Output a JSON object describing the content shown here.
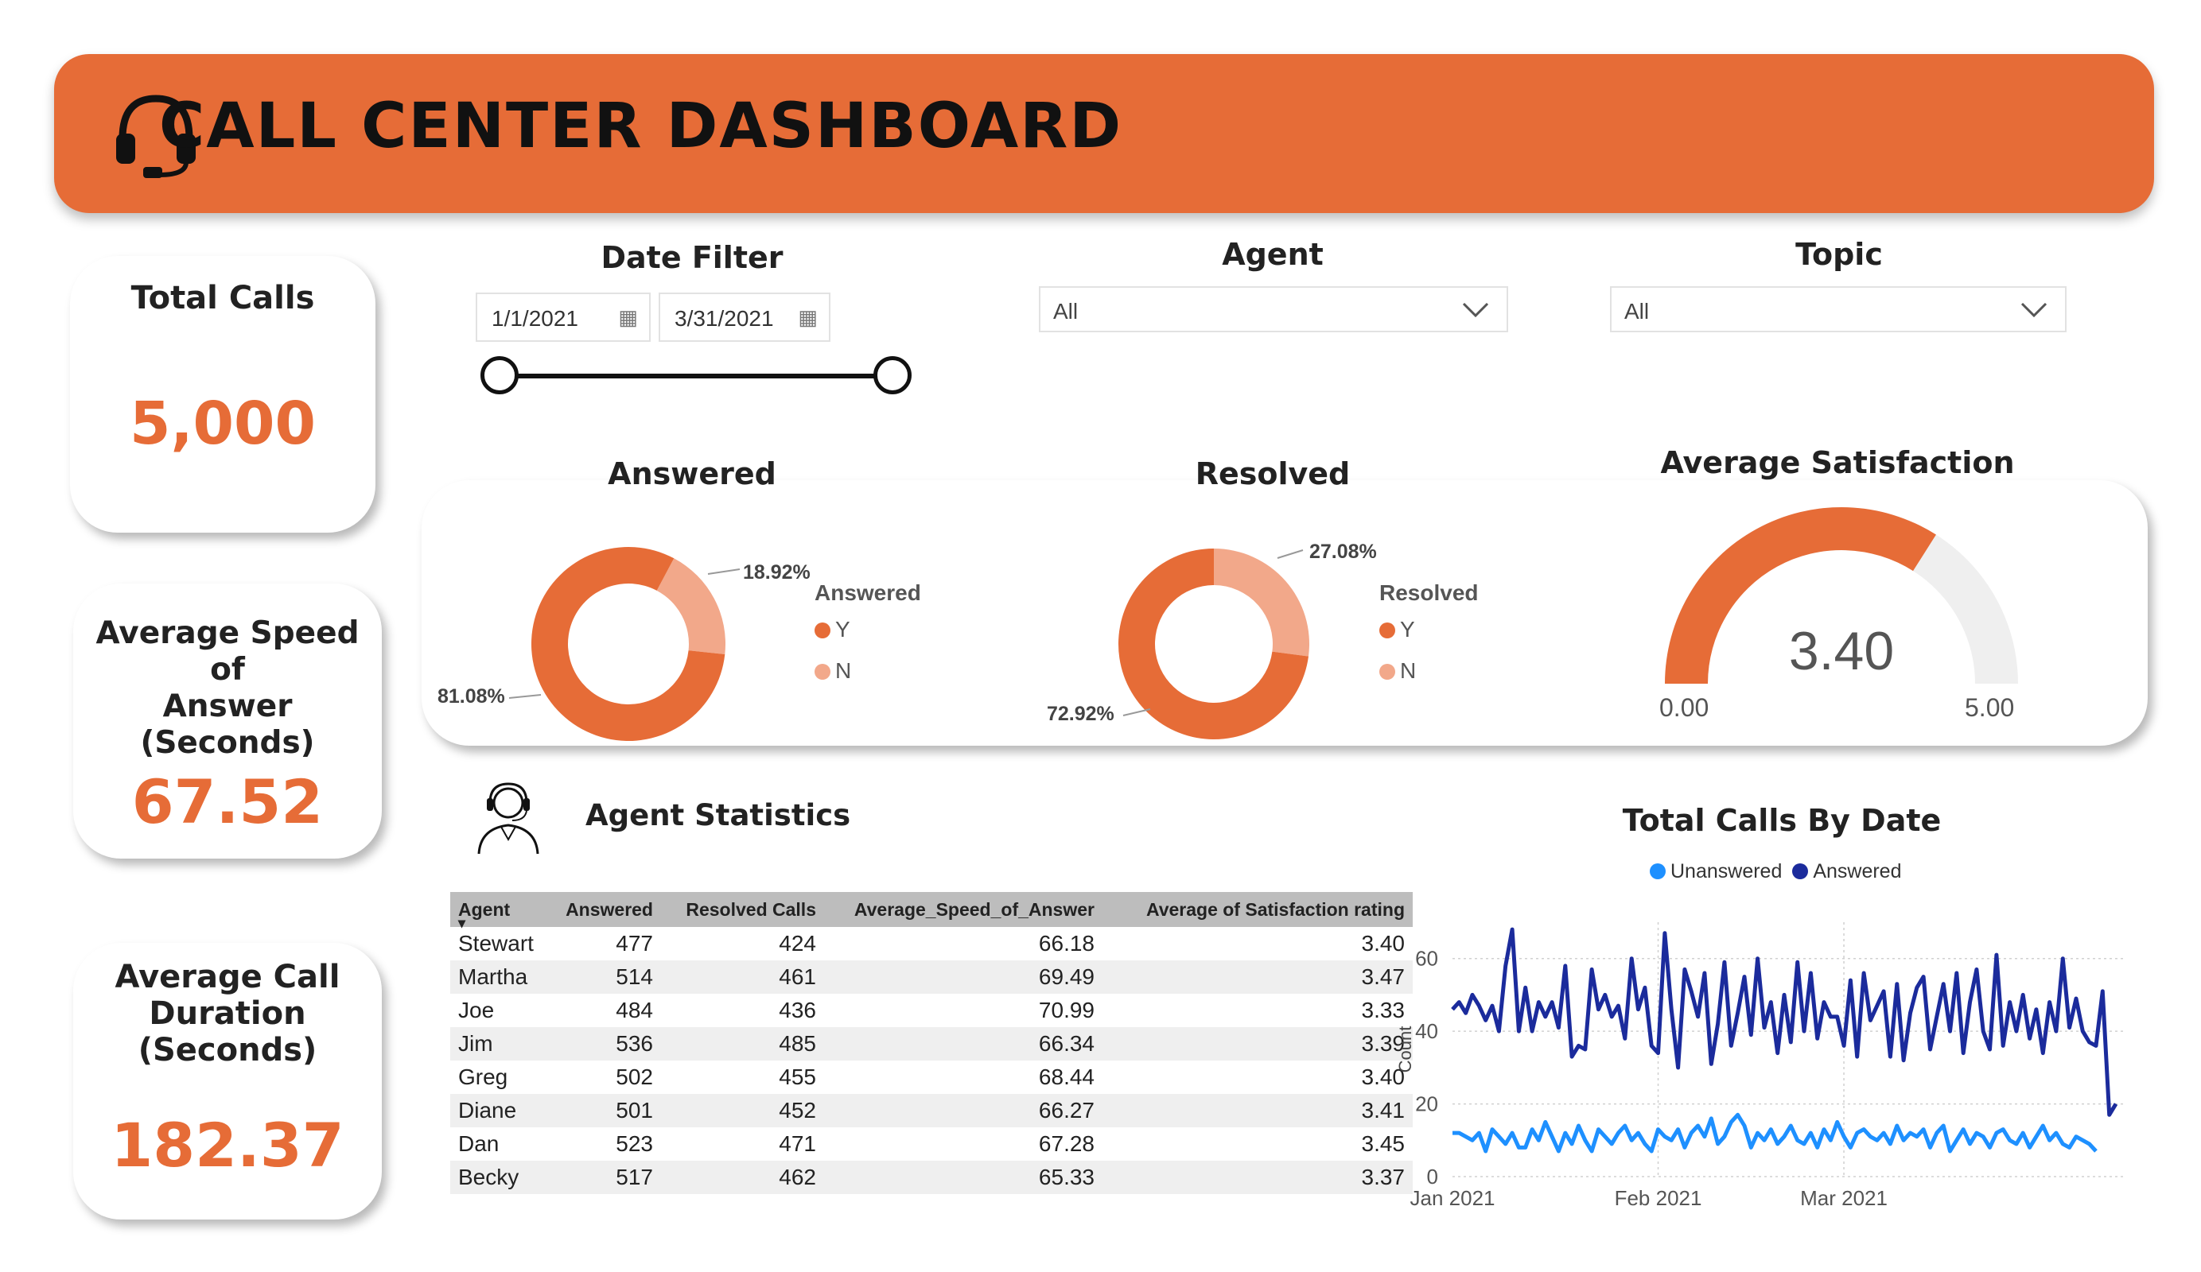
{
  "header": {
    "title": "CALL CENTER DASHBOARD",
    "icon": "headset-icon"
  },
  "kpis": {
    "total_calls": {
      "label": "Total Calls",
      "value": "5,000"
    },
    "avg_speed": {
      "label_lines": [
        "Average Speed of",
        "Answer",
        "(Seconds)"
      ],
      "value": "67.52"
    },
    "avg_duration": {
      "label_lines": [
        "Average Call",
        "Duration",
        "(Seconds)"
      ],
      "value": "182.37"
    }
  },
  "filters": {
    "date": {
      "title": "Date Filter",
      "start": "1/1/2021",
      "end": "3/31/2021"
    },
    "agent": {
      "title": "Agent",
      "value": "All"
    },
    "topic": {
      "title": "Topic",
      "value": "All"
    }
  },
  "answered": {
    "title": "Answered",
    "legend_title": "Answered",
    "legend": [
      "Y",
      "N"
    ],
    "labels": {
      "y": "81.08%",
      "n": "18.92%"
    }
  },
  "resolved": {
    "title": "Resolved",
    "legend_title": "Resolved",
    "legend": [
      "Y",
      "N"
    ],
    "labels": {
      "y": "72.92%",
      "n": "27.08%"
    }
  },
  "satisfaction": {
    "title": "Average Satisfaction",
    "value": "3.40",
    "min": "0.00",
    "max": "5.00"
  },
  "agent_stats": {
    "title": "Agent Statistics",
    "columns": [
      "Agent",
      "Answered",
      "Resolved Calls",
      "Average_Speed_of_Answer",
      "Average of Satisfaction rating"
    ],
    "rows": [
      [
        "Stewart",
        "477",
        "424",
        "66.18",
        "3.40"
      ],
      [
        "Martha",
        "514",
        "461",
        "69.49",
        "3.47"
      ],
      [
        "Joe",
        "484",
        "436",
        "70.99",
        "3.33"
      ],
      [
        "Jim",
        "536",
        "485",
        "66.34",
        "3.39"
      ],
      [
        "Greg",
        "502",
        "455",
        "68.44",
        "3.40"
      ],
      [
        "Diane",
        "501",
        "452",
        "66.27",
        "3.41"
      ],
      [
        "Dan",
        "523",
        "471",
        "67.28",
        "3.45"
      ],
      [
        "Becky",
        "517",
        "462",
        "65.33",
        "3.37"
      ]
    ]
  },
  "colors": {
    "accent": "#E66C37",
    "accent_light": "#F2A88A",
    "answered_line": "#1B2B9C",
    "unanswered_line": "#1E90FF"
  },
  "chart_data": [
    {
      "type": "pie",
      "title": "Answered",
      "categories": [
        "Y",
        "N"
      ],
      "values": [
        81.08,
        18.92
      ]
    },
    {
      "type": "pie",
      "title": "Resolved",
      "categories": [
        "Y",
        "N"
      ],
      "values": [
        72.92,
        27.08
      ]
    },
    {
      "type": "gauge",
      "title": "Average Satisfaction",
      "value": 3.4,
      "min": 0,
      "max": 5
    },
    {
      "type": "line",
      "title": "Total Calls By Date",
      "ylabel": "Count",
      "yticks": [
        "0",
        "20",
        "40",
        "60"
      ],
      "xticks": [
        "Jan 2021",
        "Feb 2021",
        "Mar 2021"
      ],
      "ylim": [
        0,
        70
      ],
      "x_start": "2021-01-01",
      "series": [
        {
          "name": "Unanswered",
          "color": "#1E90FF",
          "values": [
            12,
            12,
            11,
            10,
            12,
            7,
            13,
            11,
            9,
            12,
            8,
            8,
            13,
            10,
            15,
            11,
            7,
            12,
            9,
            14,
            10,
            7,
            13,
            11,
            9,
            12,
            14,
            10,
            12,
            9,
            7,
            13,
            11,
            10,
            13,
            8,
            12,
            14,
            11,
            16,
            9,
            11,
            15,
            17,
            14,
            8,
            12,
            10,
            13,
            9,
            11,
            14,
            10,
            9,
            12,
            8,
            13,
            10,
            15,
            11,
            8,
            12,
            13,
            11,
            10,
            12,
            9,
            14,
            10,
            12,
            11,
            13,
            8,
            12,
            14,
            7,
            10,
            13,
            9,
            12,
            11,
            8,
            12,
            13,
            10,
            9,
            12,
            8,
            11,
            14,
            10,
            12,
            9,
            8,
            11,
            10,
            9,
            7
          ]
        },
        {
          "name": "Answered",
          "color": "#1B2B9C",
          "values": [
            46,
            48,
            45,
            50,
            47,
            43,
            47,
            40,
            58,
            68,
            40,
            52,
            40,
            48,
            44,
            48,
            41,
            58,
            33,
            36,
            35,
            57,
            46,
            50,
            44,
            47,
            38,
            60,
            46,
            52,
            36,
            34,
            67,
            46,
            30,
            57,
            51,
            44,
            56,
            31,
            42,
            59,
            36,
            45,
            55,
            39,
            60,
            41,
            48,
            34,
            50,
            37,
            59,
            40,
            56,
            38,
            48,
            44,
            44,
            36,
            54,
            33,
            56,
            43,
            47,
            51,
            33,
            53,
            32,
            45,
            52,
            55,
            35,
            44,
            53,
            40,
            56,
            34,
            48,
            57,
            40,
            35,
            61,
            36,
            48,
            40,
            50,
            38,
            46,
            34,
            48,
            40,
            60,
            41,
            49,
            40,
            37,
            36,
            51,
            17,
            20
          ]
        }
      ]
    }
  ]
}
